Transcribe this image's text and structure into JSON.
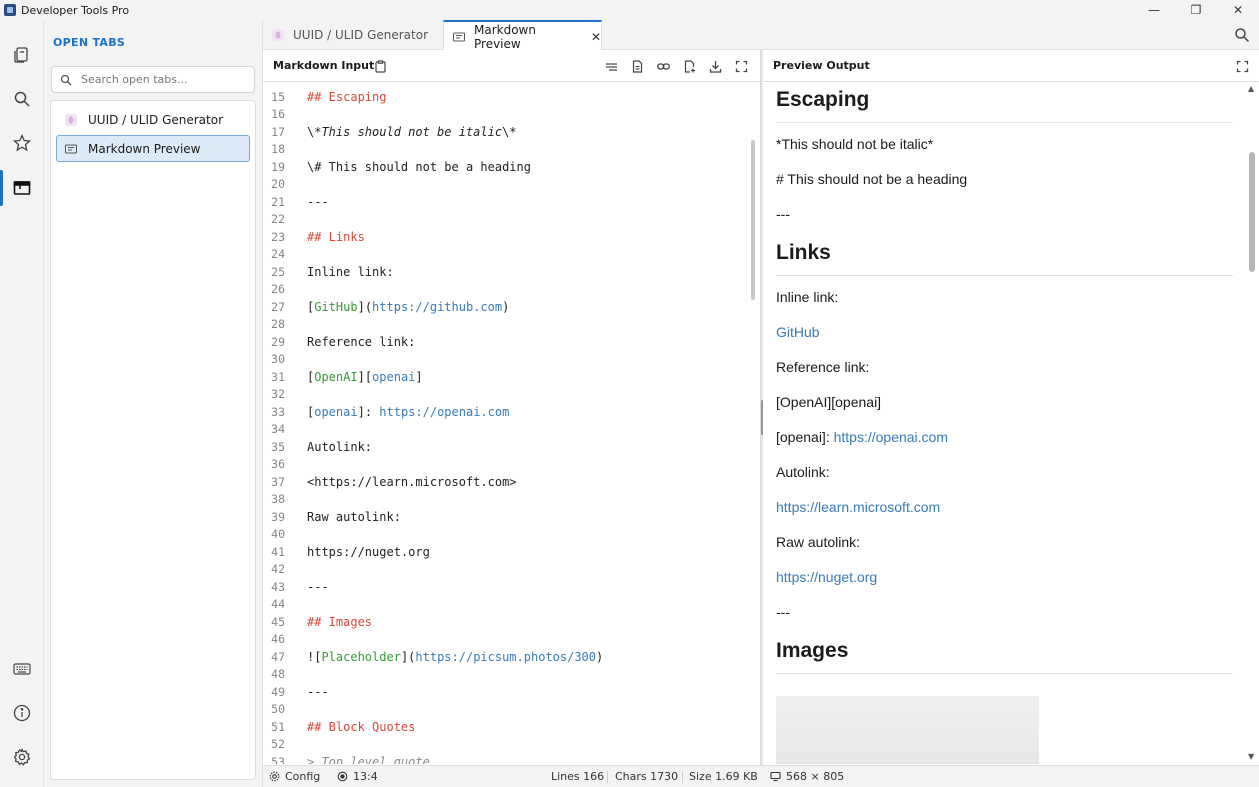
{
  "window": {
    "title": "Developer Tools Pro",
    "controls": [
      "—",
      "❐",
      "✕"
    ]
  },
  "activity_bar": {
    "items": [
      "tabs-icon",
      "search-icon",
      "star-icon",
      "window-icon"
    ],
    "bottom_items": [
      "keyboard-icon",
      "info-icon",
      "gear-icon"
    ],
    "active": "window-icon"
  },
  "open_tabs_panel": {
    "title": "OPEN TABS",
    "search_placeholder": "Search open tabs...",
    "items": [
      {
        "label": "UUID / ULID Generator",
        "icon": "uuid-icon",
        "selected": false
      },
      {
        "label": "Markdown Preview",
        "icon": "markdown-icon",
        "selected": true
      }
    ]
  },
  "doc_tabs": [
    {
      "label": "UUID / ULID Generator",
      "active": false
    },
    {
      "label": "Markdown Preview",
      "active": true,
      "close": "✕"
    }
  ],
  "input_pane": {
    "title": "Markdown Input",
    "tools": [
      "clipboard-icon",
      "wrap-icon",
      "document-icon",
      "link-icon",
      "new-file-icon",
      "download-icon",
      "fullscreen-icon"
    ]
  },
  "code_lines": [
    {
      "n": "15",
      "parts": [
        {
          "t": "## Escaping",
          "c": "head"
        }
      ]
    },
    {
      "n": "16",
      "parts": []
    },
    {
      "n": "17",
      "parts": [
        {
          "t": "\\*",
          "c": ""
        },
        {
          "t": "This should not be italic",
          "c": "italic"
        },
        {
          "t": "\\*",
          "c": ""
        }
      ]
    },
    {
      "n": "18",
      "parts": []
    },
    {
      "n": "19",
      "parts": [
        {
          "t": "\\# This should not be a heading",
          "c": ""
        }
      ]
    },
    {
      "n": "20",
      "parts": []
    },
    {
      "n": "21",
      "parts": [
        {
          "t": "---",
          "c": ""
        }
      ]
    },
    {
      "n": "22",
      "parts": []
    },
    {
      "n": "23",
      "parts": [
        {
          "t": "## Links",
          "c": "head"
        }
      ]
    },
    {
      "n": "24",
      "parts": []
    },
    {
      "n": "25",
      "parts": [
        {
          "t": "Inline link:",
          "c": ""
        }
      ]
    },
    {
      "n": "26",
      "parts": []
    },
    {
      "n": "27",
      "parts": [
        {
          "t": "[",
          "c": ""
        },
        {
          "t": "GitHub",
          "c": "label"
        },
        {
          "t": "](",
          "c": ""
        },
        {
          "t": "https://github.com",
          "c": "link"
        },
        {
          "t": ")",
          "c": ""
        }
      ]
    },
    {
      "n": "28",
      "parts": []
    },
    {
      "n": "29",
      "parts": [
        {
          "t": "Reference link:",
          "c": ""
        }
      ]
    },
    {
      "n": "30",
      "parts": []
    },
    {
      "n": "31",
      "parts": [
        {
          "t": "[",
          "c": ""
        },
        {
          "t": "OpenAI",
          "c": "label"
        },
        {
          "t": "][",
          "c": ""
        },
        {
          "t": "openai",
          "c": "link"
        },
        {
          "t": "]",
          "c": ""
        }
      ]
    },
    {
      "n": "32",
      "parts": []
    },
    {
      "n": "33",
      "parts": [
        {
          "t": "[",
          "c": ""
        },
        {
          "t": "openai",
          "c": "link"
        },
        {
          "t": "]: ",
          "c": ""
        },
        {
          "t": "https://openai.com",
          "c": "link"
        }
      ]
    },
    {
      "n": "34",
      "parts": []
    },
    {
      "n": "35",
      "parts": [
        {
          "t": "Autolink:",
          "c": ""
        }
      ]
    },
    {
      "n": "36",
      "parts": []
    },
    {
      "n": "37",
      "parts": [
        {
          "t": "<https://learn.microsoft.com>",
          "c": ""
        }
      ]
    },
    {
      "n": "38",
      "parts": []
    },
    {
      "n": "39",
      "parts": [
        {
          "t": "Raw autolink:",
          "c": ""
        }
      ]
    },
    {
      "n": "40",
      "parts": []
    },
    {
      "n": "41",
      "parts": [
        {
          "t": "https://nuget.org",
          "c": ""
        }
      ]
    },
    {
      "n": "42",
      "parts": []
    },
    {
      "n": "43",
      "parts": [
        {
          "t": "---",
          "c": ""
        }
      ]
    },
    {
      "n": "44",
      "parts": []
    },
    {
      "n": "45",
      "parts": [
        {
          "t": "## Images",
          "c": "head"
        }
      ]
    },
    {
      "n": "46",
      "parts": []
    },
    {
      "n": "47",
      "parts": [
        {
          "t": "![",
          "c": ""
        },
        {
          "t": "Placeholder",
          "c": "label"
        },
        {
          "t": "](",
          "c": ""
        },
        {
          "t": "https://picsum.photos/300",
          "c": "link"
        },
        {
          "t": ")",
          "c": ""
        }
      ]
    },
    {
      "n": "48",
      "parts": []
    },
    {
      "n": "49",
      "parts": [
        {
          "t": "---",
          "c": ""
        }
      ]
    },
    {
      "n": "50",
      "parts": []
    },
    {
      "n": "51",
      "parts": [
        {
          "t": "## Block Quotes",
          "c": "head"
        }
      ]
    },
    {
      "n": "52",
      "parts": []
    },
    {
      "n": "53",
      "parts": [
        {
          "t": "> Top level quote",
          "c": "quote"
        }
      ]
    }
  ],
  "preview_pane": {
    "title": "Preview Output",
    "blocks": [
      {
        "kind": "h",
        "text": "Escaping"
      },
      {
        "kind": "p",
        "text": "*This should not be italic*"
      },
      {
        "kind": "p",
        "text": "# This should not be a heading"
      },
      {
        "kind": "p",
        "text": "---"
      },
      {
        "kind": "h",
        "text": "Links"
      },
      {
        "kind": "p",
        "text": "Inline link:"
      },
      {
        "kind": "a",
        "text": "GitHub"
      },
      {
        "kind": "p",
        "text": "Reference link:"
      },
      {
        "kind": "p",
        "text": "[OpenAI][openai]"
      },
      {
        "kind": "mix",
        "text": "[openai]: ",
        "link": "https://openai.com"
      },
      {
        "kind": "p",
        "text": "Autolink:"
      },
      {
        "kind": "a",
        "text": "https://learn.microsoft.com"
      },
      {
        "kind": "p",
        "text": "Raw autolink:"
      },
      {
        "kind": "a",
        "text": "https://nuget.org"
      },
      {
        "kind": "p",
        "text": "---"
      },
      {
        "kind": "h",
        "text": "Images"
      }
    ]
  },
  "status_bar": {
    "config": "Config",
    "cursor": "13:4",
    "lines": "Lines 166",
    "chars": "Chars 1730",
    "size": "Size 1.69 KB",
    "viewport": "568 × 805"
  },
  "colors": {
    "accent": "#1a73c8",
    "heading": "#d9483b",
    "link": "#3a7ab8",
    "label": "#3a9a3a"
  }
}
